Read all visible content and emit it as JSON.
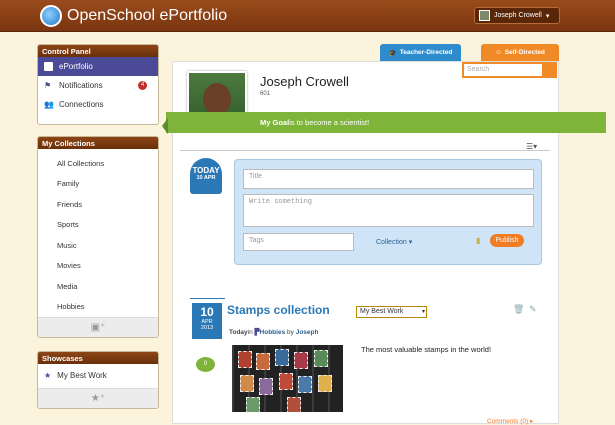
{
  "app": {
    "title": "OpenSchool ePortfolio",
    "user": "Joseph Crowell"
  },
  "control_panel": {
    "title": "Control Panel",
    "items": [
      {
        "label": "ePortfolio",
        "icon": "briefcase-icon"
      },
      {
        "label": "Notifications",
        "icon": "flag-icon",
        "badge": "4"
      },
      {
        "label": "Connections",
        "icon": "people-icon"
      }
    ]
  },
  "collections": {
    "title": "My Collections",
    "items": [
      "All Collections",
      "Family",
      "Friends",
      "Sports",
      "Music",
      "Movies",
      "Media",
      "Hobbies"
    ]
  },
  "showcases": {
    "title": "Showcases",
    "items": [
      {
        "label": "My Best Work",
        "icon": "star-icon"
      }
    ]
  },
  "tabs": {
    "teacher": "Teacher-Directed",
    "self": "Self-Directed"
  },
  "search": {
    "placeholder": "Search"
  },
  "profile": {
    "name": "Joseph Crowell",
    "id": "601",
    "goal_prefix": "My Goal",
    "goal_text": " is to become a scientist!"
  },
  "composer": {
    "today": "TODAY",
    "date": "10 APR",
    "title_ph": "Title",
    "body_ph": "Write something",
    "tags_ph": "Tags",
    "collection": "Collection",
    "publish": "Publish"
  },
  "post": {
    "day": "10",
    "month": "APR",
    "year": "2013",
    "title": "Stamps collection",
    "showcase": "My Best Work",
    "meta_today": "Today",
    "meta_in": "in",
    "meta_collection": "Hobbies",
    "meta_by": "by",
    "meta_author": "Joseph",
    "comment_count": "0",
    "caption": "The most valuable stamps in the world!",
    "comments": "Comments (0) ▸"
  }
}
